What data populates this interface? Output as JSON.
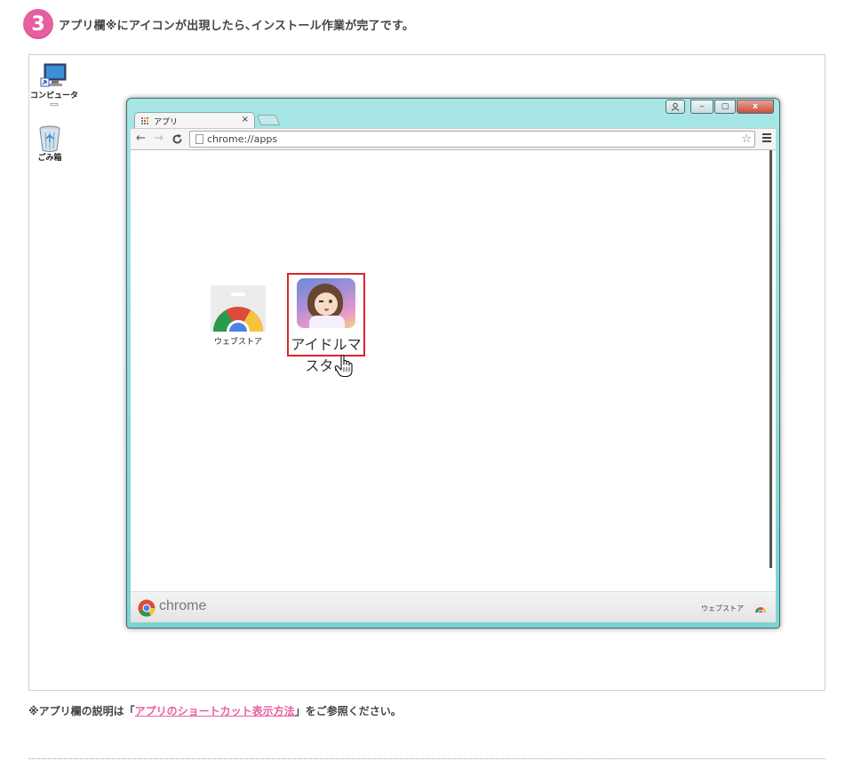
{
  "instruction": {
    "step_number": "3",
    "text": "アプリ欄※にアイコンが出現したら､インストール作業が完了です。"
  },
  "desktop": {
    "icons": [
      {
        "label": "コンピュータ",
        "icon": "computer-icon"
      },
      {
        "label": "ごみ箱",
        "icon": "recycle-bin-icon"
      }
    ]
  },
  "browser": {
    "tab_title": "アプリ",
    "tab_close": "×",
    "url": "chrome://apps",
    "controls": {
      "minimize": "‒",
      "maximize": "▢",
      "close": "x"
    },
    "apps": [
      {
        "label": "ウェブストア",
        "icon": "chrome-web-store-icon"
      },
      {
        "label": "アイドルマスタ...",
        "icon": "idolmaster-app-icon",
        "selected": true
      }
    ],
    "footer": {
      "brand": "chrome",
      "store_link": "ウェブストア"
    }
  },
  "footnote": {
    "prefix": "※アプリ欄の説明は「",
    "link_text": "アプリのショートカット表示方法",
    "suffix": "」をご参照ください。"
  },
  "colors": {
    "accent_pink": "#e75fa0",
    "selection_red": "#d9262b",
    "window_frame": "#8fdcdc"
  }
}
